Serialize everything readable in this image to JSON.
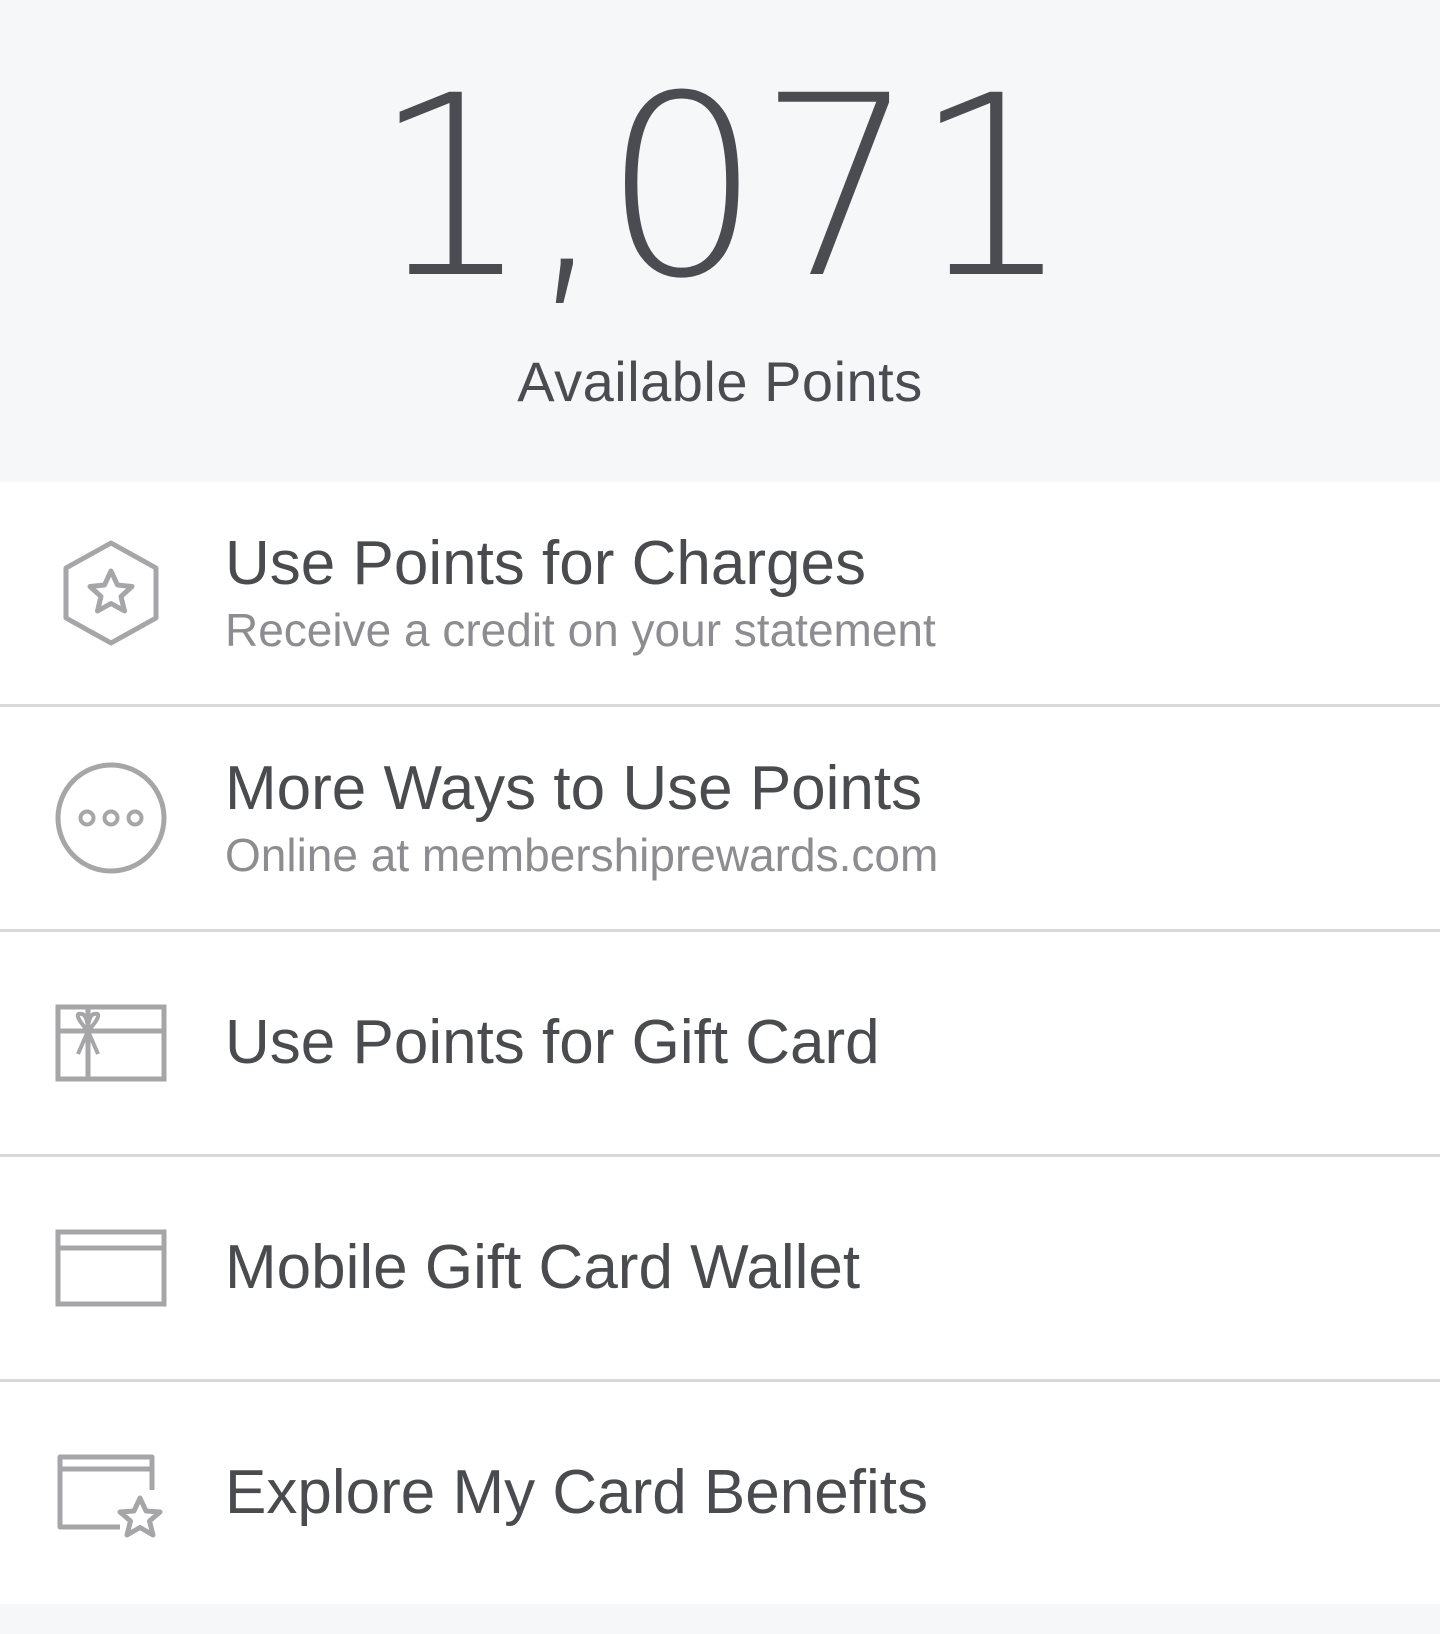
{
  "points": {
    "value": "1,071",
    "label": "Available Points"
  },
  "menu": {
    "items": [
      {
        "title": "Use Points for Charges",
        "subtitle": "Receive a credit on your statement",
        "icon": "hexagon-star-icon"
      },
      {
        "title": "More Ways to Use Points",
        "subtitle": "Online at membershiprewards.com",
        "icon": "more-options-icon"
      },
      {
        "title": "Use Points for Gift Card",
        "icon": "gift-card-icon"
      },
      {
        "title": "Mobile Gift Card Wallet",
        "icon": "card-wallet-icon"
      },
      {
        "title": "Explore My Card Benefits",
        "icon": "card-benefits-icon"
      }
    ]
  },
  "colors": {
    "header_background": "#f6f7f9",
    "text_primary": "#4a4b4f",
    "text_secondary": "#8d8d91",
    "icon_stroke": "#a6a6a8",
    "divider": "#d9d9db"
  }
}
